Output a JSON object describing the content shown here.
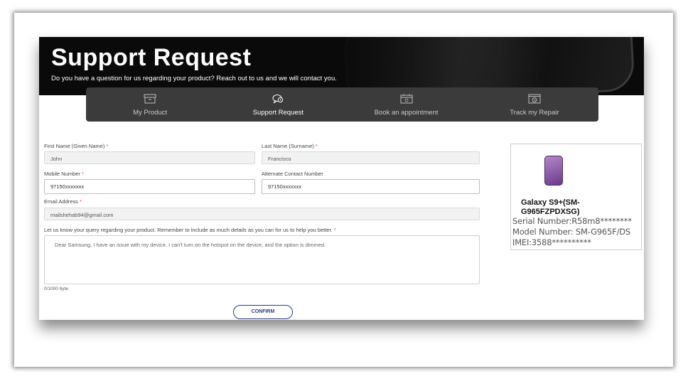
{
  "hero": {
    "title": "Support Request",
    "subtitle": "Do you have a question for us regarding your product? Reach out to us and we will contact you."
  },
  "tabs": [
    {
      "label": "My Product",
      "icon": "box-icon"
    },
    {
      "label": "Support Request",
      "icon": "chat-support-icon",
      "active": true
    },
    {
      "label": "Book an appointment",
      "icon": "calendar-icon"
    },
    {
      "label": "Track my Repair",
      "icon": "tracking-icon"
    }
  ],
  "form": {
    "first_name_label": "First Name (Given Name)",
    "first_name_value": "John",
    "last_name_label": "Last Name (Surname)",
    "last_name_value": "Francisco",
    "mobile_label": "Mobile Number",
    "mobile_value": "97150xxxxxxx",
    "alt_label": "Alternate Contact Number",
    "alt_value": "97150xxxxxxx",
    "email_label": "Email Address",
    "email_value": "mailshehab94@gmail.com",
    "query_label": "Let us know your query regarding your product. Remember to include as much details as you can for us to help you better.",
    "query_value": "Dear Samsung, I have an issue with  my device. I can't turn on the hotspot on the device, and the option is dimmed.",
    "counter": "0/1000 byte",
    "required_mark": "*",
    "confirm_label": "CONFIRM"
  },
  "device": {
    "name": "Galaxy S9+(SM-G965FZPDXSG)",
    "serial": "Serial Number:R58m8********",
    "model": "Model Number: SM-G965F/DS",
    "imei": "IMEI:3588**********"
  },
  "colors": {
    "hero_bg": "#0a0a0a",
    "tab_bar_bg": "#3b3b3b",
    "confirm_accent": "#2b3a8a",
    "required": "#d9534f"
  }
}
